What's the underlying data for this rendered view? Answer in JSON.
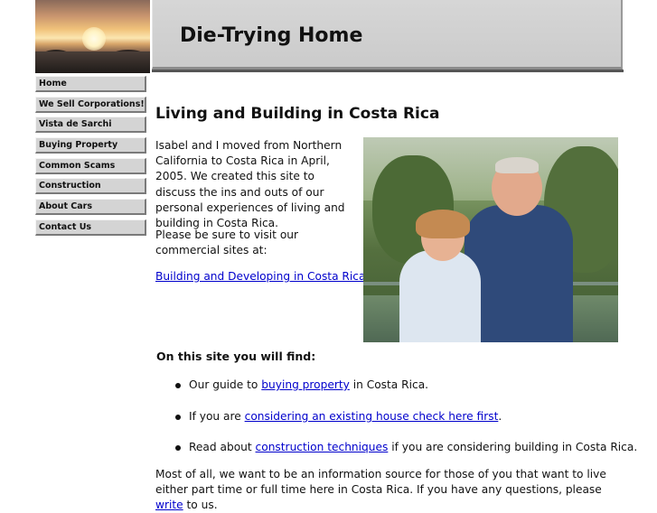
{
  "header": {
    "title": "Die-Trying Home"
  },
  "nav": {
    "items": [
      {
        "label": "Home"
      },
      {
        "label": "We Sell Corporations!"
      },
      {
        "label": "Vista de Sarchi"
      },
      {
        "label": "Buying Property"
      },
      {
        "label": "Common Scams"
      },
      {
        "label": "Construction"
      },
      {
        "label": "About Cars"
      },
      {
        "label": "Contact Us"
      }
    ]
  },
  "main": {
    "title": "Living and Building in Costa Rica",
    "intro": "Isabel and I moved from Northern California to Costa Rica in April, 2005. We created this site to discuss the ins and outs of our personal experiences of living and building in Costa Rica.",
    "visit": "Please be sure to visit our commercial sites at:",
    "commercial_link": "Building and Developing in Costa Rica",
    "find_title": "On this site you will find:",
    "bullets": [
      {
        "pre": "Our guide to ",
        "link": "buying property",
        "post": " in Costa Rica."
      },
      {
        "pre": "If you are ",
        "link": "considering an existing house check here first",
        "post": "."
      },
      {
        "pre": "Read about ",
        "link": "construction techniques",
        "post": " if you are considering building in Costa Rica."
      }
    ],
    "closing_pre": "Most of all, we want to be an information source for those of you that want to live either part time or full time here in Costa Rica.  If you have any questions, please ",
    "closing_link": "write",
    "closing_post": " to us."
  }
}
